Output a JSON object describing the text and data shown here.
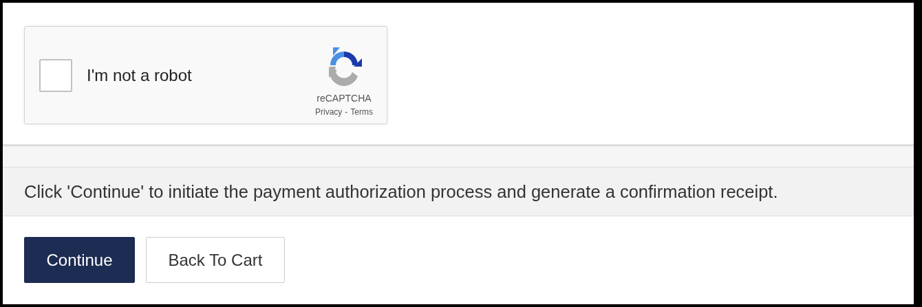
{
  "captcha": {
    "label": "I'm not a robot",
    "checked": false,
    "brand": "reCAPTCHA",
    "privacy_link": "Privacy",
    "separator": "-",
    "terms_link": "Terms"
  },
  "notice": "Click 'Continue' to initiate the payment authorization process and generate a confirmation receipt.",
  "buttons": [
    {
      "label": "Continue",
      "kind": "primary"
    },
    {
      "label": "Back To Cart",
      "kind": "secondary"
    }
  ]
}
